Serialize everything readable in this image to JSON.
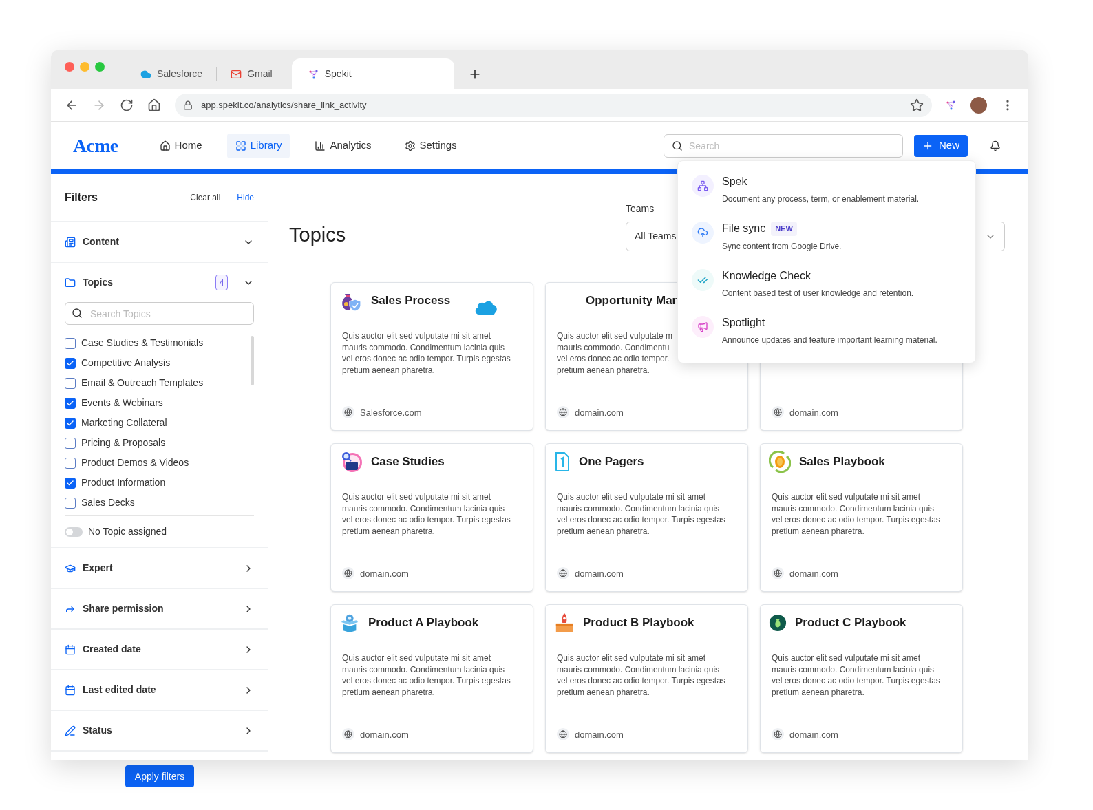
{
  "browser": {
    "tabs": [
      {
        "label": "Salesforce",
        "selected": false
      },
      {
        "label": "Gmail",
        "selected": false
      },
      {
        "label": "Spekit",
        "selected": true
      }
    ],
    "url": "app.spekit.co/analytics/share_link_activity"
  },
  "header": {
    "logo": "Acme",
    "nav": [
      {
        "label": "Home",
        "selected": false
      },
      {
        "label": "Library",
        "selected": true
      },
      {
        "label": "Analytics",
        "selected": false
      },
      {
        "label": "Settings",
        "selected": false
      }
    ],
    "search": {
      "placeholder": "Search"
    },
    "new_button": "New"
  },
  "new_menu": [
    {
      "title": "Spek",
      "description": "Document any process, term, or enablement material."
    },
    {
      "title": "File sync",
      "badge": "NEW",
      "description": "Sync content from Google Drive."
    },
    {
      "title": "Knowledge Check",
      "description": "Content based test of user knowledge and retention."
    },
    {
      "title": "Spotlight",
      "description": "Announce updates and feature important learning material."
    }
  ],
  "filters": {
    "title": "Filters",
    "clear": "Clear all",
    "hide": "Hide",
    "sections": [
      {
        "label": "Content",
        "kind": "accordion",
        "expanded": false
      },
      {
        "label": "Topics",
        "kind": "accordion",
        "expanded": true,
        "count": "4",
        "search_placeholder": "Search Topics",
        "items": [
          {
            "label": "Case Studies & Testimonials",
            "checked": false
          },
          {
            "label": "Competitive Analysis",
            "checked": true
          },
          {
            "label": "Email & Outreach Templates",
            "checked": false
          },
          {
            "label": "Events & Webinars",
            "checked": true
          },
          {
            "label": "Marketing Collateral",
            "checked": true
          },
          {
            "label": "Pricing & Proposals",
            "checked": false
          },
          {
            "label": "Product Demos & Videos",
            "checked": false
          },
          {
            "label": "Product Information",
            "checked": true
          },
          {
            "label": "Sales Decks",
            "checked": false
          }
        ],
        "toggle": {
          "label": "No Topic assigned",
          "on": false
        }
      },
      {
        "label": "Expert",
        "kind": "submenu"
      },
      {
        "label": "Share permission",
        "kind": "submenu"
      },
      {
        "label": "Created date",
        "kind": "submenu"
      },
      {
        "label": "Last edited date",
        "kind": "submenu"
      },
      {
        "label": "Status",
        "kind": "submenu"
      }
    ],
    "apply_button": "Apply filters"
  },
  "main": {
    "title": "Topics",
    "teams_label": "Teams",
    "teams_value": "All Teams",
    "cards": [
      {
        "title": "Sales Process",
        "lines": [
          "Quis auctor elit sed vulputate mi sit amet",
          "mauris commodo. Condimentum lacinia quis",
          "vel eros donec ac odio tempor. Turpis egestas",
          "pretium aenean pharetra."
        ],
        "domain": "Salesforce.com"
      },
      {
        "title": "Opportunity Man",
        "lines": [
          "Quis auctor elit sed vulputate m",
          "mauris commodo. Condimentu",
          "vel eros donec ac odio tempor.",
          "pretium aenean pharetra."
        ],
        "domain": "domain.com"
      },
      {
        "domain": "domain.com"
      },
      {
        "title": "Case Studies",
        "lines": [
          "Quis auctor elit sed vulputate mi sit amet",
          "mauris commodo. Condimentum lacinia quis",
          "vel eros donec ac odio tempor. Turpis egestas",
          "pretium aenean pharetra."
        ],
        "domain": "domain.com"
      },
      {
        "title": "One Pagers",
        "lines": [
          "Quis auctor elit sed vulputate mi sit amet",
          "mauris commodo. Condimentum lacinia quis",
          "vel eros donec ac odio tempor. Turpis egestas",
          "pretium aenean pharetra."
        ],
        "domain": "domain.com"
      },
      {
        "title": "Sales Playbook",
        "lines": [
          "Quis auctor elit sed vulputate mi sit amet",
          "mauris commodo. Condimentum lacinia quis",
          "vel eros donec ac odio tempor. Turpis egestas",
          "pretium aenean pharetra."
        ],
        "domain": "domain.com"
      },
      {
        "title": "Product A Playbook",
        "lines": [
          "Quis auctor elit sed vulputate mi sit amet",
          "mauris commodo. Condimentum lacinia quis",
          "vel eros donec ac odio tempor. Turpis egestas",
          "pretium aenean pharetra."
        ],
        "domain": "domain.com"
      },
      {
        "title": "Product B Playbook",
        "lines": [
          "Quis auctor elit sed vulputate mi sit amet",
          "mauris commodo. Condimentum lacinia quis",
          "vel eros donec ac odio tempor. Turpis egestas",
          "pretium aenean pharetra."
        ],
        "domain": "domain.com"
      },
      {
        "title": "Product C Playbook",
        "lines": [
          "Quis auctor elit sed vulputate mi sit amet",
          "mauris commodo. Condimentum lacinia quis",
          "vel eros donec ac odio tempor. Turpis egestas",
          "pretium aenean pharetra."
        ],
        "domain": "domain.com"
      }
    ]
  }
}
